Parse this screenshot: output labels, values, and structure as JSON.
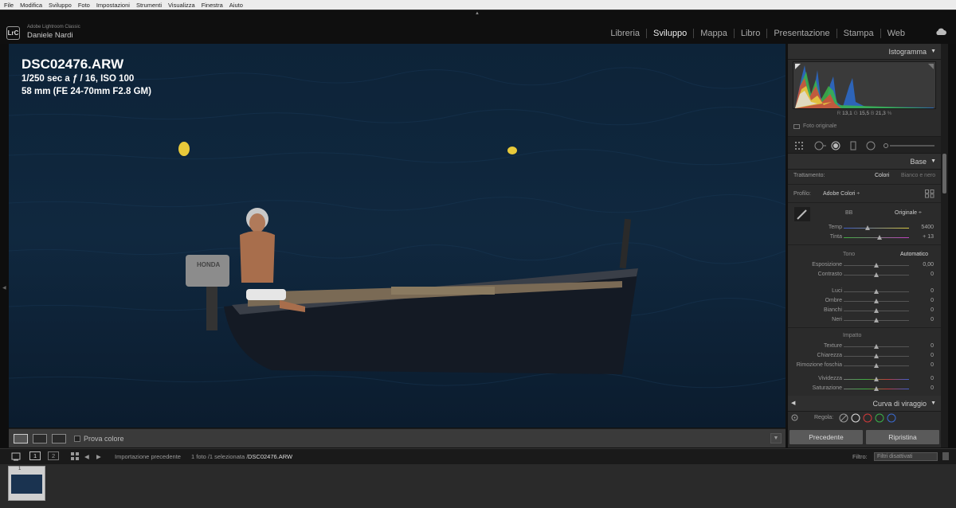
{
  "menu": [
    "File",
    "Modifica",
    "Sviluppo",
    "Foto",
    "Impostazioni",
    "Strumenti",
    "Visualizza",
    "Finestra",
    "Aiuto"
  ],
  "app": {
    "logo": "LrC",
    "name": "Adobe Lightroom Classic",
    "user": "Daniele Nardi"
  },
  "modules": [
    "Libreria",
    "Sviluppo",
    "Mappa",
    "Libro",
    "Presentazione",
    "Stampa",
    "Web"
  ],
  "active_module": "Sviluppo",
  "photo": {
    "filename": "DSC02476.ARW",
    "exposure": "1/250 sec a ƒ / 16, ISO 100",
    "lens": "58 mm (FE 24-70mm F2.8 GM)",
    "motor_brand": "HONDA"
  },
  "toolbar": {
    "proof_label": "Prova colore"
  },
  "panel": {
    "histogram_title": "Istogramma",
    "hist_values": {
      "r_label": "R",
      "r": "13,1",
      "g_label": "G",
      "g": "15,5",
      "b_label": "B",
      "b": "21,3",
      "pct": "%"
    },
    "original_photo": "Foto originale",
    "base_title": "Base",
    "treatment_label": "Trattamento:",
    "treatment_color": "Colori",
    "treatment_bw": "Bianco e nero",
    "profile_label": "Profilo:",
    "profile_value": "Adobe Colori ÷",
    "wb_label": "BB",
    "wb_value": "Originale ÷",
    "temp_label": "Temp",
    "temp_value": "5400",
    "tint_label": "Tinta",
    "tint_value": "+ 13",
    "tone_label": "Tono",
    "auto_label": "Automatico",
    "exposure_label": "Esposizione",
    "exposure_value": "0,00",
    "contrast_label": "Contrasto",
    "contrast_value": "0",
    "highlights_label": "Luci",
    "highlights_value": "0",
    "shadows_label": "Ombre",
    "shadows_value": "0",
    "whites_label": "Bianchi",
    "whites_value": "0",
    "blacks_label": "Neri",
    "blacks_value": "0",
    "presence_label": "Impatto",
    "texture_label": "Texture",
    "texture_value": "0",
    "clarity_label": "Chiarezza",
    "clarity_value": "0",
    "dehaze_label": "Rimozione foschia",
    "dehaze_value": "0",
    "vibrance_label": "Vividezza",
    "vibrance_value": "0",
    "saturation_label": "Saturazione",
    "saturation_value": "0",
    "curve_title": "Curva di viraggio",
    "adjust_label": "Regola:",
    "prev_button": "Precedente",
    "reset_button": "Ripristina"
  },
  "filmbar": {
    "page1": "1",
    "page2": "2",
    "source": "Importazione precedente",
    "count": "1 foto /1 selezionata /",
    "file": "DSC02476.ARW",
    "filter_label": "Filtro:",
    "filter_value": "Filtri disattivati"
  },
  "filmstrip": {
    "thumb_num": "1"
  },
  "colors": {
    "accent": "#e8c93a",
    "panel_bg": "#2b2b2b",
    "photo_bg": "#0e2236"
  }
}
